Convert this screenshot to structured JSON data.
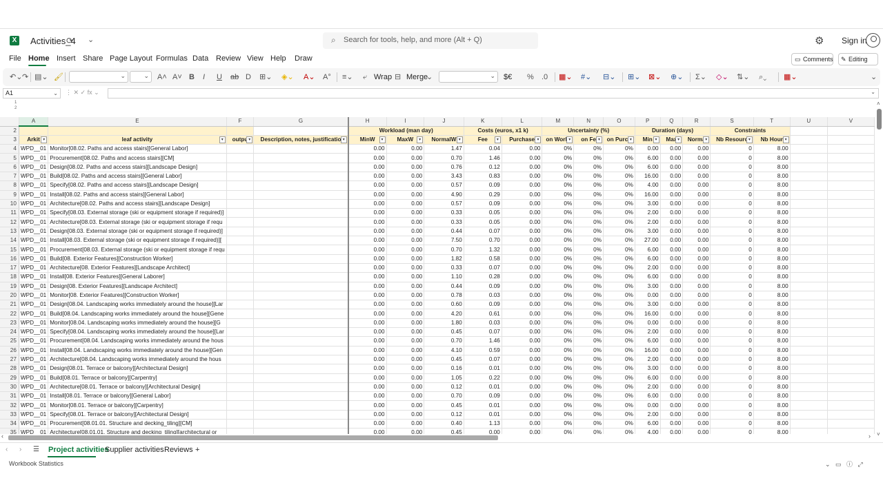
{
  "app": {
    "logo_letter": "X",
    "doc_title": "Activities_4",
    "search_placeholder": "Search for tools, help, and more (Alt + Q)",
    "sign_in": "Sign in",
    "accent": "#107c41"
  },
  "menu": {
    "items": [
      "File",
      "Home",
      "Insert",
      "Share",
      "Page Layout",
      "Formulas",
      "Data",
      "Review",
      "View",
      "Help",
      "Draw"
    ],
    "active": "Home",
    "comments": "Comments",
    "editing": "Editing"
  },
  "ribbon": {
    "wrap": "Wrap",
    "merge": "Merge",
    "currency": "$€"
  },
  "formula_bar": {
    "cell_ref": "A1",
    "fx": "fx",
    "content": ""
  },
  "columns": [
    "A",
    "E",
    "F",
    "G",
    "H",
    "I",
    "J",
    "K",
    "L",
    "M",
    "N",
    "O",
    "P",
    "Q",
    "R",
    "S",
    "T",
    "U",
    "V"
  ],
  "header_row2": {
    "workload": "Workload (man day)",
    "costs": "Costs (euros, x1 k)",
    "uncertainty": "Uncertainty (%)",
    "duration": "Duration (days)",
    "constraints": "Constraints"
  },
  "header_row3": [
    "Arkit",
    "leaf activity",
    "outpu",
    "Description, notes, justificatio",
    "MinW",
    "MaxW",
    "NormalW",
    "Fee",
    "Purchase",
    "on Workl",
    "on Fe",
    "on Purch",
    "Min",
    "Max",
    "Norma",
    "Nb Resourc",
    "Nb Hour"
  ],
  "rows": [
    {
      "n": "4",
      "a": "WPD__01",
      "e": "Monitor[08.02. Paths and access stairs][General Labor]",
      "h": "0.00",
      "i": "0.00",
      "j": "1.47",
      "k": "0.04",
      "l": "0.00",
      "m": "0%",
      "nn": "0%",
      "o": "0%",
      "p": "0.00",
      "q": "0.00",
      "r": "0.00",
      "s": "0",
      "t": "8.00"
    },
    {
      "n": "5",
      "a": "WPD__01",
      "e": "Procurement[08.02. Paths and access stairs][CM]",
      "h": "0.00",
      "i": "0.00",
      "j": "0.70",
      "k": "1.46",
      "l": "0.00",
      "m": "0%",
      "nn": "0%",
      "o": "0%",
      "p": "6.00",
      "q": "0.00",
      "r": "0.00",
      "s": "0",
      "t": "8.00"
    },
    {
      "n": "6",
      "a": "WPD__01",
      "e": "Design[08.02. Paths and access stairs][Landscape Design]",
      "h": "0.00",
      "i": "0.00",
      "j": "0.76",
      "k": "0.12",
      "l": "0.00",
      "m": "0%",
      "nn": "0%",
      "o": "0%",
      "p": "6.00",
      "q": "0.00",
      "r": "0.00",
      "s": "0",
      "t": "8.00"
    },
    {
      "n": "7",
      "a": "WPD__01",
      "e": "Build[08.02. Paths and access stairs][General Labor]",
      "h": "0.00",
      "i": "0.00",
      "j": "3.43",
      "k": "0.83",
      "l": "0.00",
      "m": "0%",
      "nn": "0%",
      "o": "0%",
      "p": "16.00",
      "q": "0.00",
      "r": "0.00",
      "s": "0",
      "t": "8.00"
    },
    {
      "n": "8",
      "a": "WPD__01",
      "e": "Specify[08.02. Paths and access stairs][Landscape Design]",
      "h": "0.00",
      "i": "0.00",
      "j": "0.57",
      "k": "0.09",
      "l": "0.00",
      "m": "0%",
      "nn": "0%",
      "o": "0%",
      "p": "4.00",
      "q": "0.00",
      "r": "0.00",
      "s": "0",
      "t": "8.00"
    },
    {
      "n": "9",
      "a": "WPD__01",
      "e": "Install[08.02. Paths and access stairs][General Labor]",
      "h": "0.00",
      "i": "0.00",
      "j": "4.90",
      "k": "0.29",
      "l": "0.00",
      "m": "0%",
      "nn": "0%",
      "o": "0%",
      "p": "16.00",
      "q": "0.00",
      "r": "0.00",
      "s": "0",
      "t": "8.00"
    },
    {
      "n": "10",
      "a": "WPD__01",
      "e": "Architecture[08.02. Paths and access stairs][Landscape Design]",
      "h": "0.00",
      "i": "0.00",
      "j": "0.57",
      "k": "0.09",
      "l": "0.00",
      "m": "0%",
      "nn": "0%",
      "o": "0%",
      "p": "3.00",
      "q": "0.00",
      "r": "0.00",
      "s": "0",
      "t": "8.00"
    },
    {
      "n": "11",
      "a": "WPD__01",
      "e": "Specify[08.03. External storage (ski or equipment storage if required)]",
      "h": "0.00",
      "i": "0.00",
      "j": "0.33",
      "k": "0.05",
      "l": "0.00",
      "m": "0%",
      "nn": "0%",
      "o": "0%",
      "p": "2.00",
      "q": "0.00",
      "r": "0.00",
      "s": "0",
      "t": "8.00"
    },
    {
      "n": "12",
      "a": "WPD__01",
      "e": "Architecture[08.03. External storage (ski or equipment storage if requ",
      "h": "0.00",
      "i": "0.00",
      "j": "0.33",
      "k": "0.05",
      "l": "0.00",
      "m": "0%",
      "nn": "0%",
      "o": "0%",
      "p": "2.00",
      "q": "0.00",
      "r": "0.00",
      "s": "0",
      "t": "8.00"
    },
    {
      "n": "13",
      "a": "WPD__01",
      "e": "Design[08.03. External storage (ski or equipment storage if required)]",
      "h": "0.00",
      "i": "0.00",
      "j": "0.44",
      "k": "0.07",
      "l": "0.00",
      "m": "0%",
      "nn": "0%",
      "o": "0%",
      "p": "3.00",
      "q": "0.00",
      "r": "0.00",
      "s": "0",
      "t": "8.00"
    },
    {
      "n": "14",
      "a": "WPD__01",
      "e": "Install[08.03. External storage (ski or equipment storage if required)][",
      "h": "0.00",
      "i": "0.00",
      "j": "7.50",
      "k": "0.70",
      "l": "0.00",
      "m": "0%",
      "nn": "0%",
      "o": "0%",
      "p": "27.00",
      "q": "0.00",
      "r": "0.00",
      "s": "0",
      "t": "8.00"
    },
    {
      "n": "15",
      "a": "WPD__01",
      "e": "Procurement[08.03. External storage (ski or equipment storage if requ",
      "h": "0.00",
      "i": "0.00",
      "j": "0.70",
      "k": "1.32",
      "l": "0.00",
      "m": "0%",
      "nn": "0%",
      "o": "0%",
      "p": "6.00",
      "q": "0.00",
      "r": "0.00",
      "s": "0",
      "t": "8.00"
    },
    {
      "n": "16",
      "a": "WPD__01",
      "e": "Build[08. Exterior Features][Construction Worker]",
      "h": "0.00",
      "i": "0.00",
      "j": "1.82",
      "k": "0.58",
      "l": "0.00",
      "m": "0%",
      "nn": "0%",
      "o": "0%",
      "p": "6.00",
      "q": "0.00",
      "r": "0.00",
      "s": "0",
      "t": "8.00"
    },
    {
      "n": "17",
      "a": "WPD__01",
      "e": "Architecture[08. Exterior Features][Landscape Architect]",
      "h": "0.00",
      "i": "0.00",
      "j": "0.33",
      "k": "0.07",
      "l": "0.00",
      "m": "0%",
      "nn": "0%",
      "o": "0%",
      "p": "2.00",
      "q": "0.00",
      "r": "0.00",
      "s": "0",
      "t": "8.00"
    },
    {
      "n": "18",
      "a": "WPD__01",
      "e": "Install[08. Exterior Features][General Laborer]",
      "h": "0.00",
      "i": "0.00",
      "j": "1.10",
      "k": "0.28",
      "l": "0.00",
      "m": "0%",
      "nn": "0%",
      "o": "0%",
      "p": "6.00",
      "q": "0.00",
      "r": "0.00",
      "s": "0",
      "t": "8.00"
    },
    {
      "n": "19",
      "a": "WPD__01",
      "e": "Design[08. Exterior Features][Landscape Architect]",
      "h": "0.00",
      "i": "0.00",
      "j": "0.44",
      "k": "0.09",
      "l": "0.00",
      "m": "0%",
      "nn": "0%",
      "o": "0%",
      "p": "3.00",
      "q": "0.00",
      "r": "0.00",
      "s": "0",
      "t": "8.00"
    },
    {
      "n": "20",
      "a": "WPD__01",
      "e": "Monitor[08. Exterior Features][Construction Worker]",
      "h": "0.00",
      "i": "0.00",
      "j": "0.78",
      "k": "0.03",
      "l": "0.00",
      "m": "0%",
      "nn": "0%",
      "o": "0%",
      "p": "0.00",
      "q": "0.00",
      "r": "0.00",
      "s": "0",
      "t": "8.00"
    },
    {
      "n": "21",
      "a": "WPD__01",
      "e": "Design[08.04. Landscaping works immediately around the house][Lar",
      "h": "0.00",
      "i": "0.00",
      "j": "0.60",
      "k": "0.09",
      "l": "0.00",
      "m": "0%",
      "nn": "0%",
      "o": "0%",
      "p": "3.00",
      "q": "0.00",
      "r": "0.00",
      "s": "0",
      "t": "8.00"
    },
    {
      "n": "22",
      "a": "WPD__01",
      "e": "Build[08.04. Landscaping works immediately around the house][Gene",
      "h": "0.00",
      "i": "0.00",
      "j": "4.20",
      "k": "0.61",
      "l": "0.00",
      "m": "0%",
      "nn": "0%",
      "o": "0%",
      "p": "16.00",
      "q": "0.00",
      "r": "0.00",
      "s": "0",
      "t": "8.00"
    },
    {
      "n": "23",
      "a": "WPD__01",
      "e": "Monitor[08.04. Landscaping works immediately around the house][G",
      "h": "0.00",
      "i": "0.00",
      "j": "1.80",
      "k": "0.03",
      "l": "0.00",
      "m": "0%",
      "nn": "0%",
      "o": "0%",
      "p": "0.00",
      "q": "0.00",
      "r": "0.00",
      "s": "0",
      "t": "8.00"
    },
    {
      "n": "24",
      "a": "WPD__01",
      "e": "Specify[08.04. Landscaping works immediately around the house][Lar",
      "h": "0.00",
      "i": "0.00",
      "j": "0.45",
      "k": "0.07",
      "l": "0.00",
      "m": "0%",
      "nn": "0%",
      "o": "0%",
      "p": "2.00",
      "q": "0.00",
      "r": "0.00",
      "s": "0",
      "t": "8.00"
    },
    {
      "n": "25",
      "a": "WPD__01",
      "e": "Procurement[08.04. Landscaping works immediately around the hous",
      "h": "0.00",
      "i": "0.00",
      "j": "0.70",
      "k": "1.46",
      "l": "0.00",
      "m": "0%",
      "nn": "0%",
      "o": "0%",
      "p": "6.00",
      "q": "0.00",
      "r": "0.00",
      "s": "0",
      "t": "8.00"
    },
    {
      "n": "26",
      "a": "WPD__01",
      "e": "Install[08.04. Landscaping works immediately around the house][Gen",
      "h": "0.00",
      "i": "0.00",
      "j": "4.10",
      "k": "0.59",
      "l": "0.00",
      "m": "0%",
      "nn": "0%",
      "o": "0%",
      "p": "16.00",
      "q": "0.00",
      "r": "0.00",
      "s": "0",
      "t": "8.00"
    },
    {
      "n": "27",
      "a": "WPD__01",
      "e": "Architecture[08.04. Landscaping works immediately around the hous",
      "h": "0.00",
      "i": "0.00",
      "j": "0.45",
      "k": "0.07",
      "l": "0.00",
      "m": "0%",
      "nn": "0%",
      "o": "0%",
      "p": "2.00",
      "q": "0.00",
      "r": "0.00",
      "s": "0",
      "t": "8.00"
    },
    {
      "n": "28",
      "a": "WPD__01",
      "e": "Design[08.01. Terrace or balcony][Architectural Design]",
      "h": "0.00",
      "i": "0.00",
      "j": "0.16",
      "k": "0.01",
      "l": "0.00",
      "m": "0%",
      "nn": "0%",
      "o": "0%",
      "p": "3.00",
      "q": "0.00",
      "r": "0.00",
      "s": "0",
      "t": "8.00"
    },
    {
      "n": "29",
      "a": "WPD__01",
      "e": "Build[08.01. Terrace or balcony][Carpentry]",
      "h": "0.00",
      "i": "0.00",
      "j": "1.05",
      "k": "0.22",
      "l": "0.00",
      "m": "0%",
      "nn": "0%",
      "o": "0%",
      "p": "6.00",
      "q": "0.00",
      "r": "0.00",
      "s": "0",
      "t": "8.00"
    },
    {
      "n": "30",
      "a": "WPD__01",
      "e": "Architecture[08.01. Terrace or balcony][Architectural Design]",
      "h": "0.00",
      "i": "0.00",
      "j": "0.12",
      "k": "0.01",
      "l": "0.00",
      "m": "0%",
      "nn": "0%",
      "o": "0%",
      "p": "2.00",
      "q": "0.00",
      "r": "0.00",
      "s": "0",
      "t": "8.00"
    },
    {
      "n": "31",
      "a": "WPD__01",
      "e": "Install[08.01. Terrace or balcony][General Labor]",
      "h": "0.00",
      "i": "0.00",
      "j": "0.70",
      "k": "0.09",
      "l": "0.00",
      "m": "0%",
      "nn": "0%",
      "o": "0%",
      "p": "6.00",
      "q": "0.00",
      "r": "0.00",
      "s": "0",
      "t": "8.00"
    },
    {
      "n": "32",
      "a": "WPD__01",
      "e": "Monitor[08.01. Terrace or balcony][Carpentry]",
      "h": "0.00",
      "i": "0.00",
      "j": "0.45",
      "k": "0.01",
      "l": "0.00",
      "m": "0%",
      "nn": "0%",
      "o": "0%",
      "p": "0.00",
      "q": "0.00",
      "r": "0.00",
      "s": "0",
      "t": "8.00"
    },
    {
      "n": "33",
      "a": "WPD__01",
      "e": "Specify[08.01. Terrace or balcony][Architectural Design]",
      "h": "0.00",
      "i": "0.00",
      "j": "0.12",
      "k": "0.01",
      "l": "0.00",
      "m": "0%",
      "nn": "0%",
      "o": "0%",
      "p": "2.00",
      "q": "0.00",
      "r": "0.00",
      "s": "0",
      "t": "8.00"
    },
    {
      "n": "34",
      "a": "WPD__01",
      "e": "Procurement[08.01.01. Structure and decking_tiling][CM]",
      "h": "0.00",
      "i": "0.00",
      "j": "0.40",
      "k": "1.13",
      "l": "0.00",
      "m": "0%",
      "nn": "0%",
      "o": "0%",
      "p": "6.00",
      "q": "0.00",
      "r": "0.00",
      "s": "0",
      "t": "8.00"
    },
    {
      "n": "35",
      "a": "WPD__01",
      "e": "Architecture[08.01.01. Structure and decking_tiling][architectural or",
      "h": "0.00",
      "i": "0.00",
      "j": "0.45",
      "k": "0.00",
      "l": "0.00",
      "m": "0%",
      "nn": "0%",
      "o": "0%",
      "p": "4.00",
      "q": "0.00",
      "r": "0.00",
      "s": "0",
      "t": "8.00"
    }
  ],
  "sheets": {
    "tabs": [
      "Project activities",
      "Supplier activities",
      "Reviews"
    ],
    "active": "Project activities",
    "add": "+"
  },
  "status": {
    "text": "Workbook Statistics"
  }
}
